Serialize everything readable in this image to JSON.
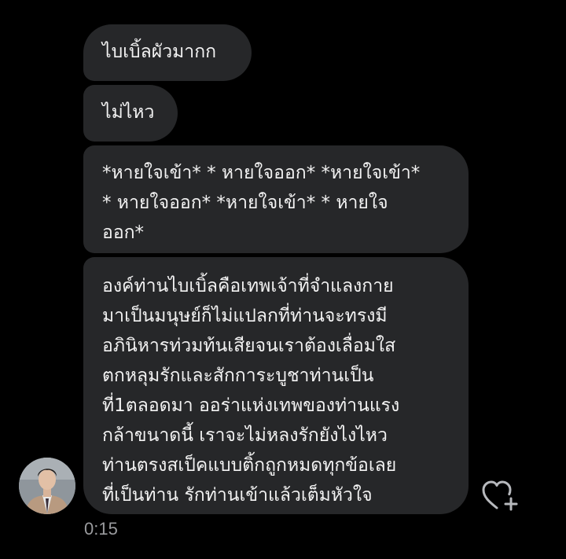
{
  "messages": [
    {
      "text": "ไบเบิ้ลผัวมากก"
    },
    {
      "text": "ไม่ไหว"
    },
    {
      "text": "*หายใจเข้า* * หายใจออก* *หายใจเข้า*\n* หายใจออก* *หายใจเข้า* * หายใจ\nออก*"
    },
    {
      "text": "องค์ท่านไบเบิ้ลคือเทพเจ้าที่จำแลงกาย\nมาเป็นมนุษย์ก็ไม่แปลกที่ท่านจะทรงมี\nอภินิหารท่วมท้นเสียจนเราต้องเลื่อมใส\nตกหลุมรักและสักการะบูชาท่านเป็น\nที่1ตลอดมา ออร่าแห่งเทพของท่านแรง\nกล้าขนาดนี้ เราจะไม่หลงรักยังไงไหว\nท่านตรงสเป็คแบบติ้กถูกหมดทุกข้อเลย\nที่เป็นท่าน รักท่านเข้าแล้วเต็มหัวใจ"
    }
  ],
  "timestamp": "0:15",
  "icons": {
    "react": "heart-plus-icon",
    "avatar": "profile-avatar"
  },
  "colors": {
    "background": "#000000",
    "bubble": "#262729",
    "text": "#f2f2f2",
    "timestamp": "#9a9b9e"
  }
}
